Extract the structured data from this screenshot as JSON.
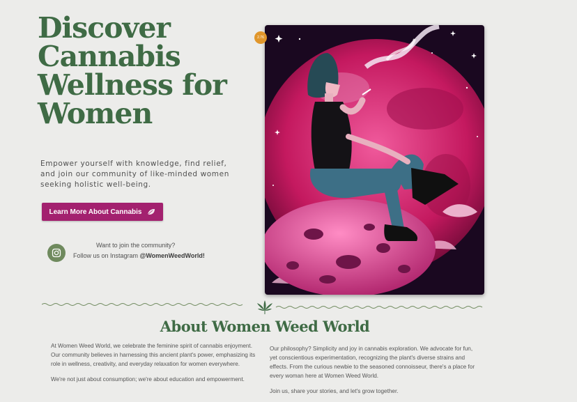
{
  "hero": {
    "title_lines": [
      "Discover",
      "Cannabis",
      "Wellness for",
      "Women"
    ],
    "subtitle": "Empower yourself with knowledge, find relief, and join our community of like-minded women seeking holistic well-being.",
    "cta_label": "Learn More About Cannabis",
    "badge_text": "2.76"
  },
  "community": {
    "question": "Want to join the community?",
    "follow_prefix": "Follow us on Instagram ",
    "handle": "@WomenWeedWorld!"
  },
  "about": {
    "title": "About Women Weed World",
    "left_paragraphs": [
      "At Women Weed World, we celebrate the feminine spirit of cannabis enjoyment. Our community believes in harnessing this ancient plant's power, emphasizing its role in wellness, creativity, and everyday relaxation for women everywhere.",
      "We're not just about consumption; we're about education and empowerment."
    ],
    "right_paragraphs": [
      "Our philosophy? Simplicity and joy in cannabis exploration. We advocate for fun, yet conscientious experimentation, recognizing the plant's diverse strains and effects. From the curious newbie to the seasoned connoisseur, there's a place for every woman here at Women Weed World.",
      "Join us, share your stories, and let's grow together."
    ]
  },
  "colors": {
    "brand_green": "#3f6b45",
    "cta_magenta": "#a3216f",
    "icon_green": "#6f8a5e",
    "background": "#ececea"
  },
  "icons": {
    "cta": "leaf-icon",
    "community": "instagram-icon",
    "divider": "cannabis-leaf-icon"
  }
}
